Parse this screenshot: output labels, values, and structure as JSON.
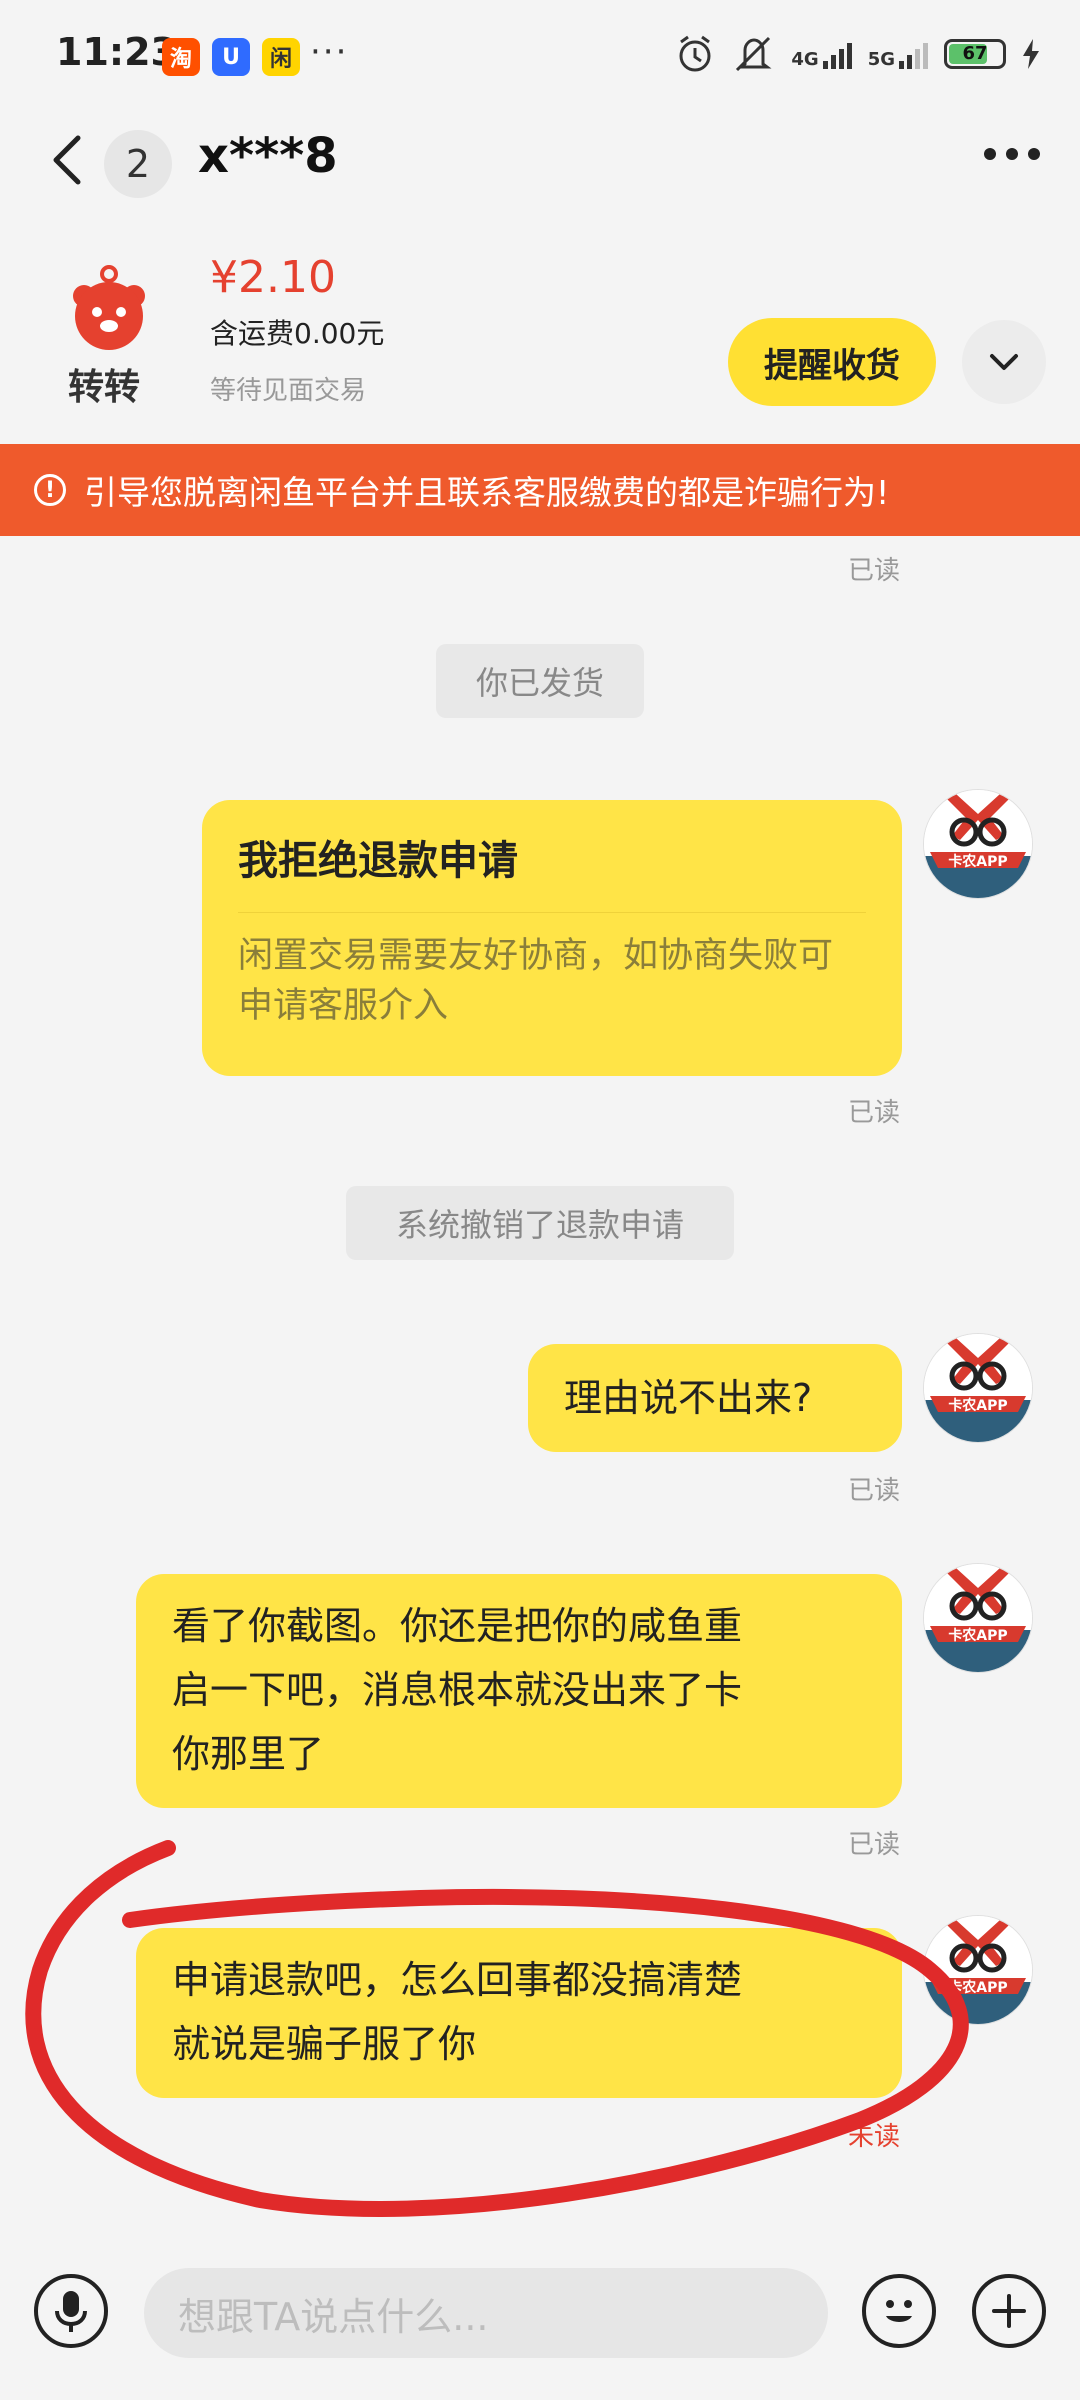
{
  "status_bar": {
    "time": "11:23",
    "apps": [
      {
        "name": "taobao-app-icon",
        "glyph": "淘",
        "color": "#ff5000"
      },
      {
        "name": "blue-app-icon",
        "glyph": "U",
        "color": "#2f6bff"
      },
      {
        "name": "yellow-app-icon",
        "glyph": "闲",
        "color": "#ffd400"
      }
    ],
    "more": "···",
    "network_1": "4G",
    "network_2": "5G",
    "battery": "67"
  },
  "header": {
    "back_icon": "chevron-left-icon",
    "unread_count": "2",
    "title": "x***8",
    "more_icon": "more-dots-icon"
  },
  "product": {
    "logo_text": "转转",
    "price": "¥2.10",
    "shipping": "含运费0.00元",
    "status": "等待见面交易",
    "remind_button": "提醒收货"
  },
  "warning": {
    "text": "引导您脱离闲鱼平台并且联系客服缴费的都是诈骗行为!",
    "color": "#ef5a2c"
  },
  "chat": {
    "read_top": "已读",
    "system_1": "你已发货",
    "card": {
      "title": "我拒绝退款申请",
      "body": "闲置交易需要友好协商，如协商失败可申请客服介入",
      "read": "已读"
    },
    "system_2": "系统撤销了退款申请",
    "msg_1": {
      "text": "理由说不出来?",
      "read": "已读"
    },
    "msg_2": {
      "line1": "看了你截图。你还是把你的咸鱼重",
      "line2": "启一下吧，消息根本就没出来了卡",
      "line3": "你那里了",
      "read": "已读"
    },
    "msg_3": {
      "line1": "申请退款吧，怎么回事都没搞清楚",
      "line2": "就说是骗子服了你",
      "status": "未读"
    },
    "avatar_label": "卡农APP"
  },
  "input_bar": {
    "placeholder": "想跟TA说点什么...",
    "mic_icon": "microphone-icon",
    "emoji_icon": "emoji-icon",
    "plus_icon": "plus-icon"
  },
  "colors": {
    "bubble": "#ffe447",
    "accent_red": "#e5412f",
    "annotation": "#e02a2a"
  }
}
